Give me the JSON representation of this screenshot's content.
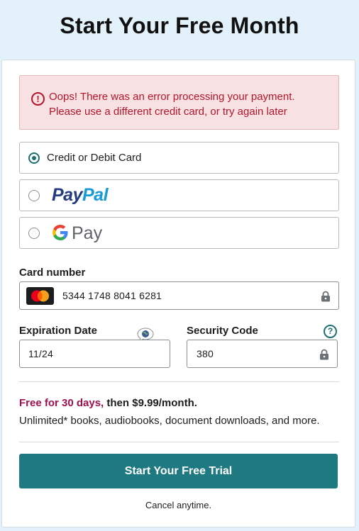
{
  "header": {
    "title": "Start Your Free Month"
  },
  "error": {
    "icon": "alert-circle-icon",
    "line1": "Oops! There was an error processing your payment.",
    "line2": "Please use a different credit card, or try again later"
  },
  "payment_methods": {
    "card": {
      "label": "Credit or Debit Card",
      "selected": true
    },
    "paypal": {
      "logo_part1": "Pay",
      "logo_part2": "Pal",
      "selected": false
    },
    "gpay": {
      "logo_text": "Pay",
      "selected": false
    }
  },
  "card_number": {
    "label": "Card number",
    "value": "5344 1748 8041 6281",
    "brand_icon": "mastercard-icon"
  },
  "expiration": {
    "label": "Expiration Date",
    "value": "11/24"
  },
  "security_code": {
    "label": "Security Code",
    "value": "380",
    "help_icon": "question-circle-icon"
  },
  "offer": {
    "free_text": "Free for 30 days,",
    "then_text": " then $9.99/month.",
    "details": "Unlimited* books, audiobooks, document downloads, and more."
  },
  "cta": {
    "label": "Start Your Free Trial"
  },
  "footer": {
    "cancel_note": "Cancel anytime."
  },
  "colors": {
    "page_bg": "#e3f1fb",
    "accent": "#1e7a80",
    "error_text": "#b4162c",
    "error_bg": "#f7e1e2",
    "offer_highlight": "#9e1050"
  }
}
